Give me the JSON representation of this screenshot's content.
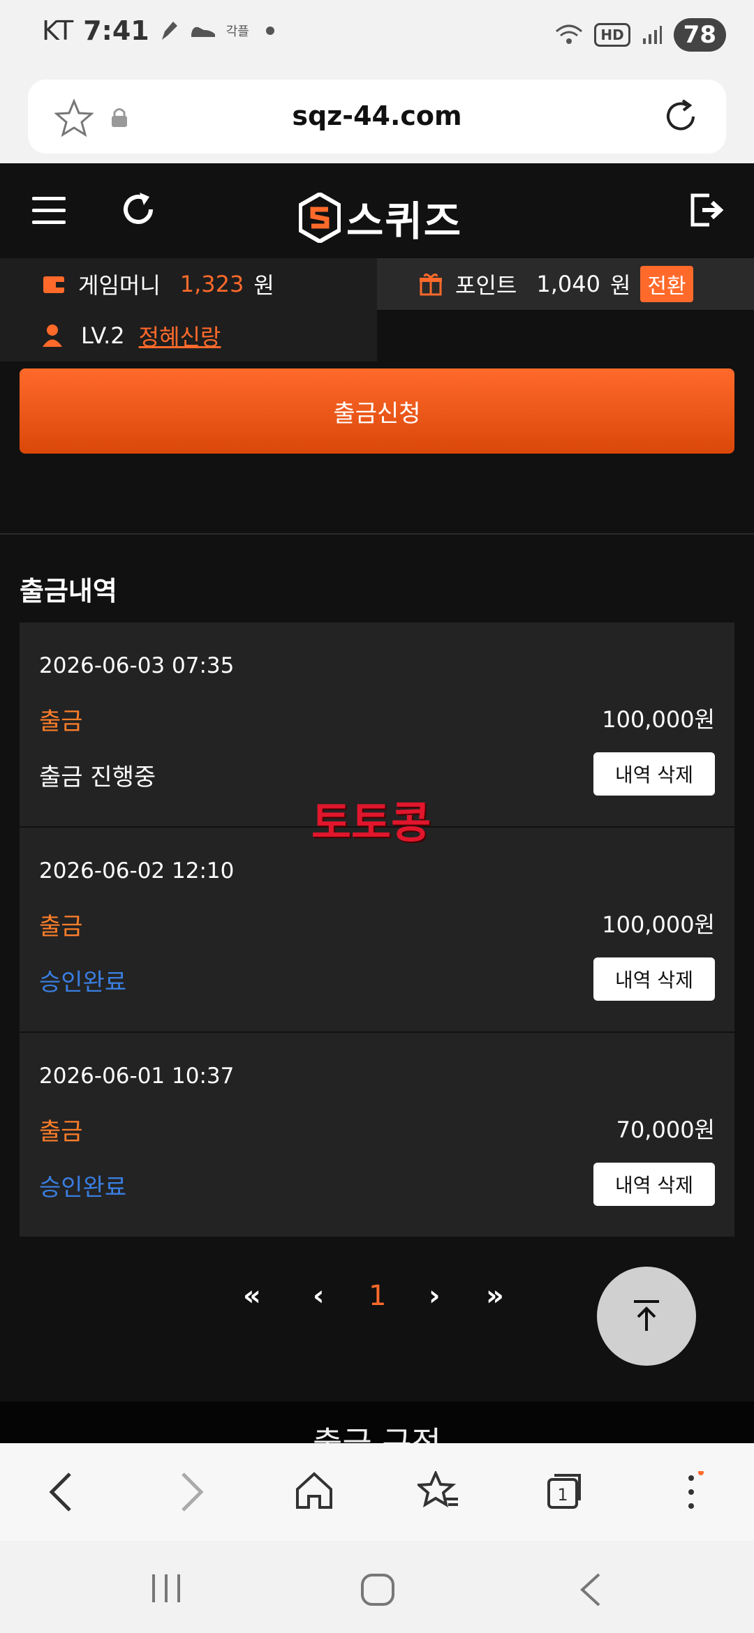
{
  "status_bar": {
    "carrier": "KT",
    "time": "7:41",
    "notif_text": "각플",
    "hd": "HD",
    "battery": "78"
  },
  "browser": {
    "url": "sqz-44.com"
  },
  "site": {
    "brand": "스퀴즈"
  },
  "account": {
    "money_label": "게임머니",
    "money_value": "1,323",
    "money_unit": "원",
    "point_label": "포인트",
    "point_value": "1,040",
    "point_unit": "원",
    "convert_label": "전환",
    "level": "LV.2",
    "nickname": "정혜신랑"
  },
  "withdraw_button": "출금신청",
  "history_title": "출금내역",
  "history": [
    {
      "date": "2026-06-03 07:35",
      "type": "출금",
      "amount": "100,000원",
      "status": "출금 진행중",
      "delete_label": "내역 삭제"
    },
    {
      "date": "2026-06-02 12:10",
      "type": "출금",
      "amount": "100,000원",
      "status": "승인완료",
      "delete_label": "내역 삭제"
    },
    {
      "date": "2026-06-01 10:37",
      "type": "출금",
      "amount": "70,000원",
      "status": "승인완료",
      "delete_label": "내역 삭제"
    }
  ],
  "watermark": "토토콩",
  "pagination": {
    "first": "«",
    "prev": "‹",
    "current": "1",
    "next": "›",
    "last": "»"
  },
  "rules_title": "출금 규정",
  "colors": {
    "accent": "#ff6a2b",
    "approved": "#3a7ee0",
    "background": "#111111"
  }
}
